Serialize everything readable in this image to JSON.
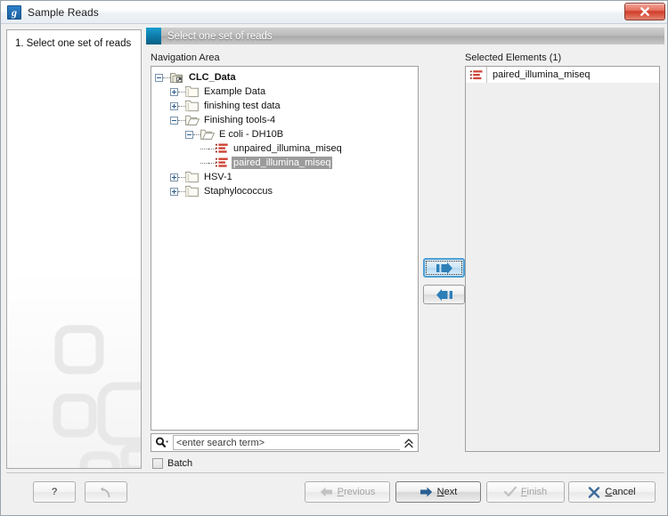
{
  "window": {
    "title": "Sample Reads",
    "app_icon": "clc-g-icon",
    "close_label": "x"
  },
  "sidebar": {
    "steps": [
      {
        "number": "1.",
        "label": "Select one set of reads"
      }
    ]
  },
  "banner": {
    "title": "Select one set of reads"
  },
  "navigation": {
    "label": "Navigation Area",
    "tree": [
      {
        "label": "CLC_Data",
        "depth": 0,
        "icon": "clc-data-folder-icon",
        "state": "expanded",
        "bold": true,
        "selected": false
      },
      {
        "label": "Example Data",
        "depth": 1,
        "icon": "folder-closed-icon",
        "state": "collapsed",
        "bold": false,
        "selected": false
      },
      {
        "label": "finishing test data",
        "depth": 1,
        "icon": "folder-closed-icon",
        "state": "collapsed",
        "bold": false,
        "selected": false
      },
      {
        "label": "Finishing tools-4",
        "depth": 1,
        "icon": "folder-open-icon",
        "state": "expanded",
        "bold": false,
        "selected": false
      },
      {
        "label": "E coli - DH10B",
        "depth": 2,
        "icon": "folder-open-icon",
        "state": "expanded",
        "bold": false,
        "selected": false
      },
      {
        "label": "unpaired_illumina_miseq",
        "depth": 3,
        "icon": "sequence-reads-icon",
        "state": "leaf",
        "bold": false,
        "selected": false
      },
      {
        "label": "paired_illumina_miseq",
        "depth": 3,
        "icon": "sequence-reads-icon",
        "state": "leaf",
        "bold": false,
        "selected": true
      },
      {
        "label": "HSV-1",
        "depth": 1,
        "icon": "folder-closed-icon",
        "state": "collapsed",
        "bold": false,
        "selected": false
      },
      {
        "label": "Staphylococcus",
        "depth": 1,
        "icon": "folder-closed-icon",
        "state": "collapsed",
        "bold": false,
        "selected": false
      }
    ]
  },
  "search": {
    "placeholder": "<enter search term>",
    "value": "",
    "icon": "search-magnifier-icon",
    "expand_icon": "double-chevron-up-icon"
  },
  "batch": {
    "label": "Batch",
    "checked": false
  },
  "transfer": {
    "add_icon": "arrow-right-icon",
    "add_label": "",
    "remove_icon": "arrow-left-icon",
    "remove_label": ""
  },
  "selected_elements": {
    "label": "Selected Elements (1)",
    "count": 1,
    "items": [
      {
        "label": "paired_illumina_miseq",
        "icon": "sequence-reads-icon"
      }
    ]
  },
  "footer": {
    "help_label": "?",
    "reset_label": "",
    "previous_label": "Previous",
    "previous_mnemonic": "P",
    "next_label": "Next",
    "next_mnemonic": "N",
    "finish_label": "Finish",
    "finish_mnemonic": "F",
    "cancel_label": "Cancel",
    "cancel_mnemonic": "C"
  },
  "colors": {
    "accent": "#1b9fd1",
    "close_red": "#cf3d2a",
    "selection_gray": "#9b9b9b",
    "reads_red": "#c0392b",
    "folder_gold": "#e8c878"
  }
}
